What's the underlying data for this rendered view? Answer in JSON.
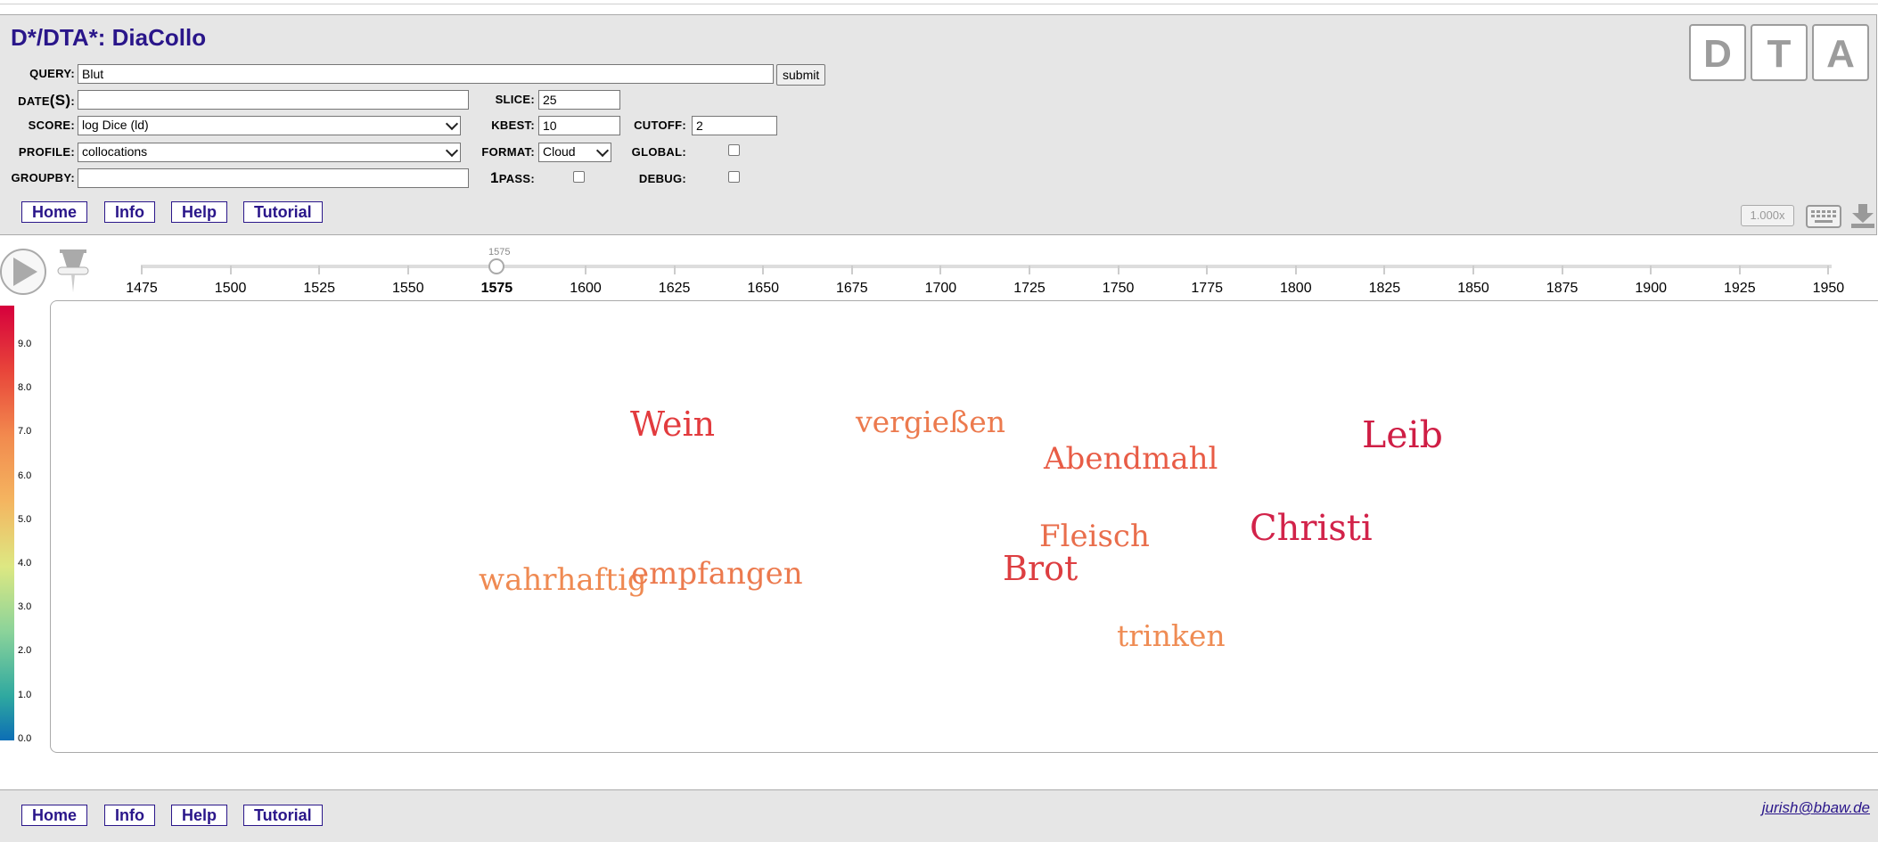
{
  "app": {
    "title": "D*/DTA*: DiaCollo"
  },
  "form": {
    "query_label": "QUERY",
    "query_value": "Blut",
    "submit_label": "submit",
    "dates_label": "DATE",
    "dates_label_paren": "(S)",
    "dates_value": "",
    "slice_label": "SLICE",
    "slice_value": "25",
    "score_label": "SCORE",
    "score_value": "log Dice (ld)",
    "kbest_label": "KBEST",
    "kbest_value": "10",
    "cutoff_label": "CUTOFF",
    "cutoff_value": "2",
    "profile_label": "PROFILE",
    "profile_value": "collocations",
    "format_label": "FORMAT",
    "format_value": "Cloud",
    "global_label": "GLOBAL",
    "groupby_label": "GROUPBY",
    "groupby_value": "",
    "onepass_prefix": "1",
    "onepass_label": "PASS",
    "debug_label": "DEBUG",
    "colon": ":"
  },
  "nav": {
    "home": "Home",
    "info": "Info",
    "help": "Help",
    "tutorial": "Tutorial"
  },
  "logo": {
    "letters": [
      "D",
      "T",
      "A"
    ]
  },
  "toolbar": {
    "zoom_label": "1.000x",
    "keyboard_icon": "keyboard-icon",
    "download_icon": "download-icon"
  },
  "slider": {
    "current_label": "1575",
    "current_value": 1575,
    "ticks": [
      "1475",
      "1500",
      "1525",
      "1550",
      "1575",
      "1600",
      "1625",
      "1650",
      "1675",
      "1700",
      "1725",
      "1750",
      "1775",
      "1800",
      "1825",
      "1850",
      "1875",
      "1900",
      "1925",
      "1950"
    ],
    "active_tick": "1575"
  },
  "colorbar": {
    "labels": [
      "9.0",
      "8.0",
      "7.0",
      "6.0",
      "5.0",
      "4.0",
      "3.0",
      "2.0",
      "1.0",
      "0.0"
    ]
  },
  "cloud": {
    "words": [
      {
        "text": "Wein",
        "color": "#e23b3e"
      },
      {
        "text": "vergießen",
        "color": "#ec7a4e"
      },
      {
        "text": "Abendmahl",
        "color": "#e85c46"
      },
      {
        "text": "Leib",
        "color": "#cf1e45"
      },
      {
        "text": "Fleisch",
        "color": "#e96e4c"
      },
      {
        "text": "Christi",
        "color": "#d2234a"
      },
      {
        "text": "Brot",
        "color": "#dd3e41"
      },
      {
        "text": "wahrhaftig",
        "color": "#ef8a52"
      },
      {
        "text": "empfangen",
        "color": "#ec7a4e"
      },
      {
        "text": "trinken",
        "color": "#ef8c54"
      }
    ]
  },
  "footer": {
    "email": "jurish@bbaw.de"
  }
}
